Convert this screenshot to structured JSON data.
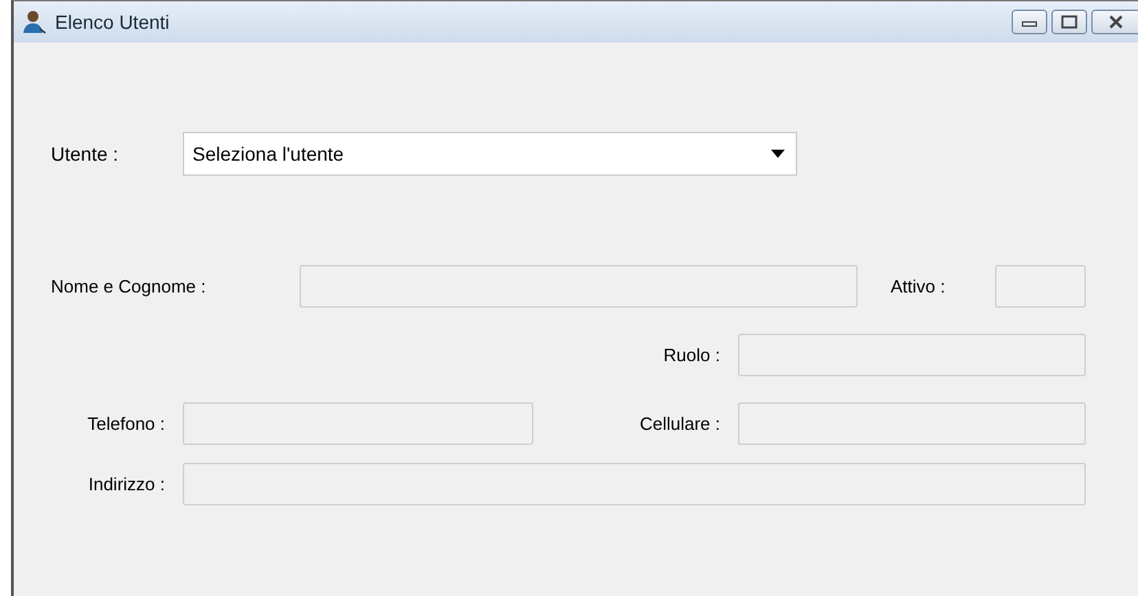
{
  "window": {
    "title": "Elenco Utenti"
  },
  "user_select": {
    "label": "Utente :",
    "value": "Seleziona l'utente"
  },
  "fields": [
    {
      "label": "Nome e Cognome :",
      "disabled": true
    },
    {
      "label": "Attivo :",
      "disabled": true
    },
    {
      "label": "Ruolo :",
      "disabled": true
    },
    {
      "label": "Telefono :",
      "disabled": true
    },
    {
      "label": "Cellulare :",
      "disabled": true
    },
    {
      "label": "Indirizzo :",
      "disabled": true
    }
  ]
}
